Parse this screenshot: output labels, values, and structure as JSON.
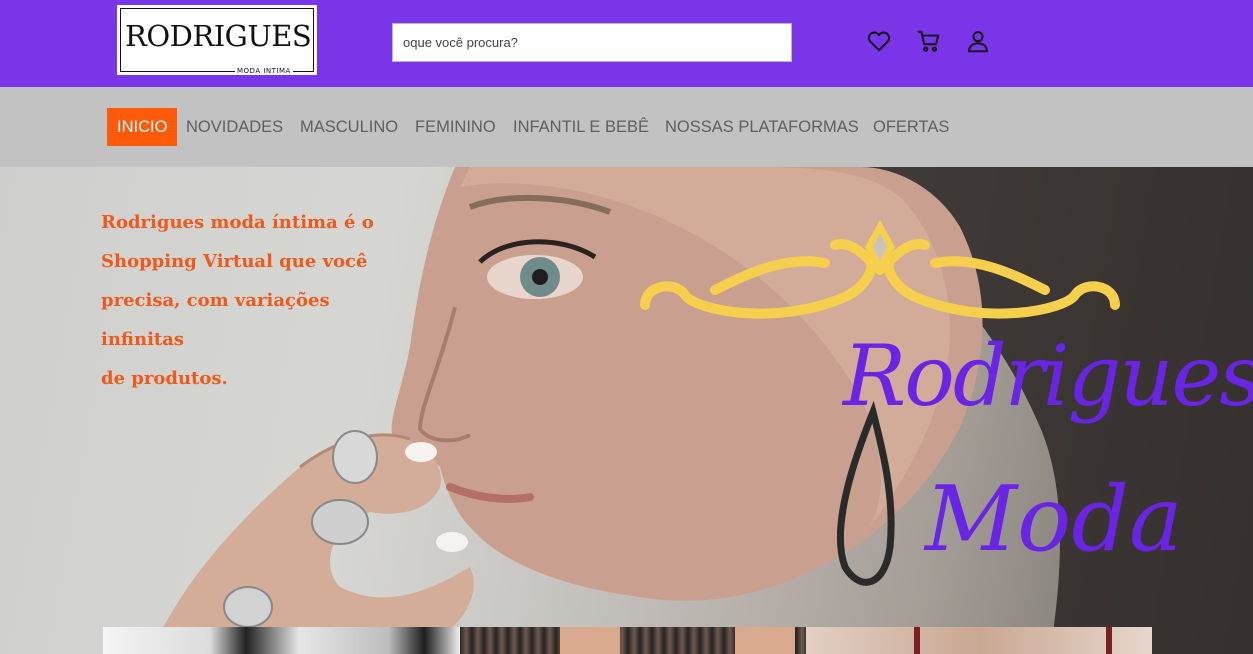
{
  "logo": {
    "title": "RODRIGUES",
    "subtitle": "MODA INTIMA"
  },
  "search": {
    "placeholder": "oque você procura?",
    "value": ""
  },
  "header_icons": [
    "heart-icon",
    "cart-icon",
    "user-icon"
  ],
  "nav": {
    "items": [
      {
        "label": "INICIO",
        "active": true
      },
      {
        "label": "NOVIDADES",
        "active": false
      },
      {
        "label": "MASCULINO",
        "active": false
      },
      {
        "label": "FEMININO",
        "active": false
      },
      {
        "label": "INFANTIL E BEBÊ",
        "active": false
      },
      {
        "label": "NOSSAS PLATAFORMAS",
        "active": false
      },
      {
        "label": "OFERTAS",
        "active": false
      }
    ]
  },
  "hero": {
    "tagline_lines": [
      "Rodrigues moda íntima é o",
      "Shopping Virtual que você",
      "precisa, com variações infinitas",
      "de produtos."
    ],
    "brand_line1": "Rodrigues",
    "brand_line2": "Moda"
  },
  "colors": {
    "header_bg": "#7b35e8",
    "nav_bg": "#c2c2c2",
    "active_nav": "#ff5a0a",
    "tagline": "#ef5a1b",
    "brand_script": "#6a24e6",
    "ornament": "#f6d04d"
  }
}
